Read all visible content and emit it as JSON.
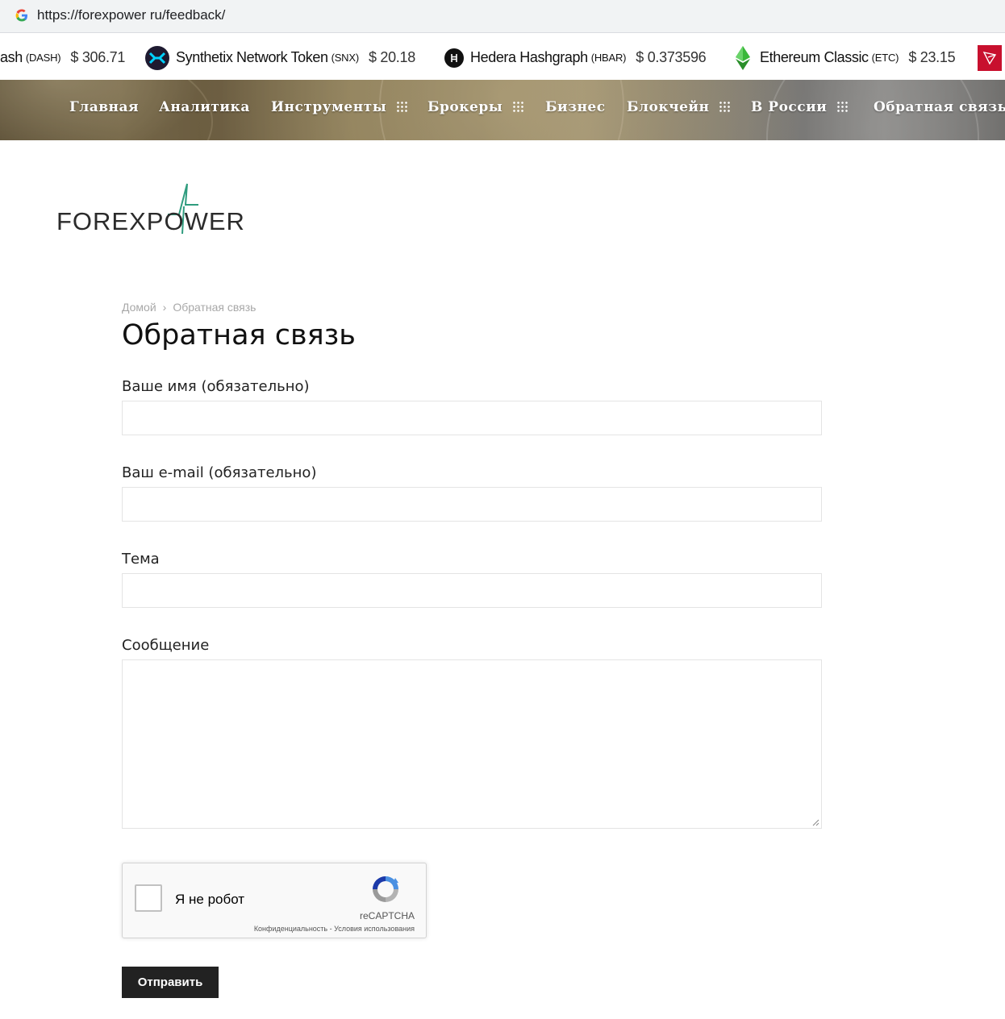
{
  "browser": {
    "url": "https://forexpower ru/feedback/"
  },
  "ticker": [
    {
      "name": "ash",
      "symbol": "(DASH)",
      "price": "$ 306.71",
      "icon": "dash-icon"
    },
    {
      "name": "Synthetix Network Token",
      "symbol": "(SNX)",
      "price": "$ 20.18",
      "icon": "synthetix-icon",
      "color": "#1e1a31"
    },
    {
      "name": "Hedera Hashgraph",
      "symbol": "(HBAR)",
      "price": "$ 0.373596",
      "icon": "hedera-icon",
      "color": "#111111"
    },
    {
      "name": "Ethereum Classic",
      "symbol": "(ETC)",
      "price": "$ 23.15",
      "icon": "ethereum-classic-icon",
      "color": "#3ab83a"
    }
  ],
  "nav": {
    "items": [
      {
        "label": "Главная",
        "has_submenu": false
      },
      {
        "label": "Аналитика",
        "has_submenu": false
      },
      {
        "label": "Инструменты",
        "has_submenu": true
      },
      {
        "label": "Брокеры",
        "has_submenu": true
      },
      {
        "label": "Бизнес",
        "has_submenu": false
      },
      {
        "label": "Блокчейн",
        "has_submenu": true
      },
      {
        "label": "В России",
        "has_submenu": true
      },
      {
        "label": "Обратная связь",
        "has_submenu": false
      }
    ]
  },
  "logo": {
    "text": "FOREXPOWER",
    "accent_color": "#2f9c7e"
  },
  "breadcrumb": {
    "home": "Домой",
    "separator": "›",
    "current": "Обратная связь"
  },
  "page": {
    "title": "Обратная связь"
  },
  "form": {
    "name_label": "Ваше имя (обязательно)",
    "name_value": "",
    "email_label": "Ваш e-mail (обязательно)",
    "email_value": "",
    "subject_label": "Тема",
    "subject_value": "",
    "message_label": "Сообщение",
    "message_value": "",
    "submit_label": "Отправить"
  },
  "recaptcha": {
    "label": "Я не робот",
    "brand": "reCAPTCHA",
    "links": "Конфиденциальность - Условия использования",
    "checked": false
  }
}
